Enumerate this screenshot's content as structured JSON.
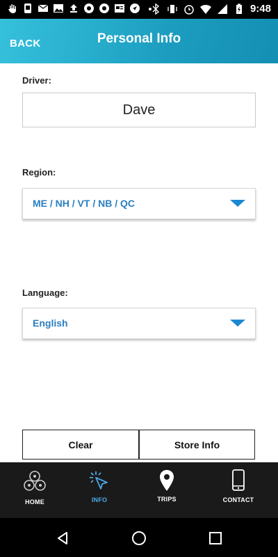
{
  "status_bar": {
    "time": "9:48"
  },
  "header": {
    "back_label": "BACK",
    "title": "Personal Info"
  },
  "form": {
    "driver": {
      "label": "Driver:",
      "value": "Dave"
    },
    "region": {
      "label": "Region:",
      "value": "ME / NH / VT / NB / QC"
    },
    "language": {
      "label": "Language:",
      "value": "English"
    }
  },
  "buttons": {
    "clear": "Clear",
    "store": "Store Info"
  },
  "tabs": [
    {
      "label": "HOME",
      "icon": "home-icon",
      "active": false
    },
    {
      "label": "INFO",
      "icon": "cursor-click-icon",
      "active": true
    },
    {
      "label": "TRIPS",
      "icon": "map-pin-icon",
      "active": false
    },
    {
      "label": "CONTACT",
      "icon": "phone-icon",
      "active": false
    }
  ],
  "colors": {
    "accent": "#2a7fc1",
    "header_start": "#35c0db",
    "header_end": "#148fb4",
    "tab_active": "#4aa8e6"
  }
}
